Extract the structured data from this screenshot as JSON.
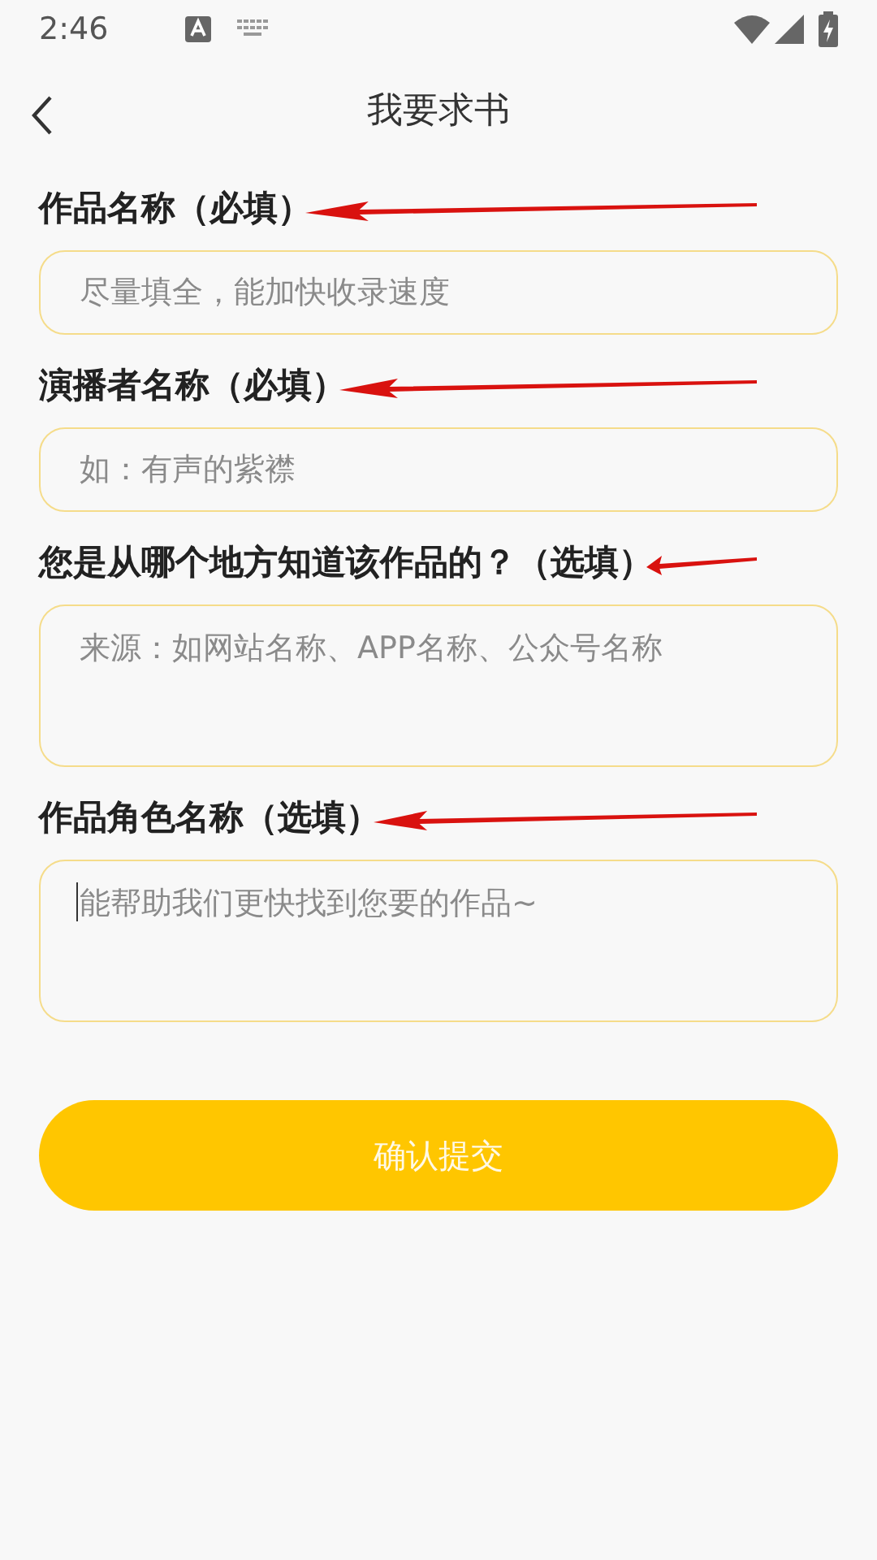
{
  "status_bar": {
    "time": "2:46"
  },
  "header": {
    "title": "我要求书"
  },
  "fields": [
    {
      "kind": "single",
      "label": "作品名称（必填）",
      "placeholder": "尽量填全，能加快收录速度",
      "focused": false
    },
    {
      "kind": "single",
      "label": "演播者名称（必填）",
      "placeholder": "如：有声的紫襟",
      "focused": false
    },
    {
      "kind": "multi",
      "label": "您是从哪个地方知道该作品的？（选填）",
      "placeholder": "来源：如网站名称、APP名称、公众号名称",
      "focused": false
    },
    {
      "kind": "multi",
      "label": "作品角色名称（选填）",
      "placeholder": "能帮助我们更快找到您要的作品~",
      "focused": true
    }
  ],
  "submit_button": {
    "label": "确认提交"
  }
}
